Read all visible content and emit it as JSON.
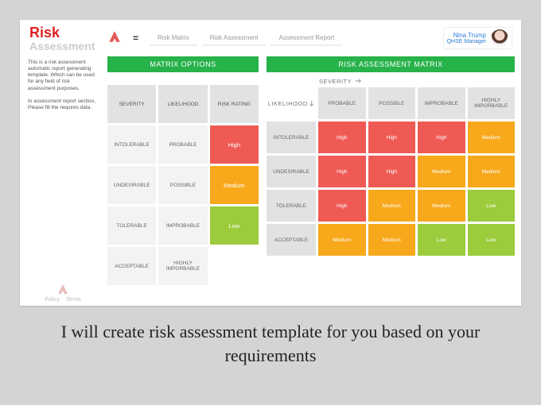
{
  "header": {
    "brand_line1": "Risk",
    "brand_line2": "Assessment",
    "hamburger": "=",
    "tabs": [
      "Risk Matrix",
      "Risk Assessment",
      "Assessment Report"
    ],
    "user_name": "Nina Trump",
    "user_role": "QHSE Manager"
  },
  "left": {
    "para1": "This is a risk assessment automatic report generating template. Which can be used for any field of risk assessment purposes.",
    "para2": "In assessment report section, Please fill the requires data.",
    "foot_links": [
      "Policy",
      "Terms"
    ]
  },
  "options": {
    "title": "MATRIX OPTIONS",
    "headers": [
      "SEVERITY",
      "LIKELIHOOD",
      "RISK RATING"
    ],
    "rows": [
      {
        "severity": "INTOLERABLE",
        "likelihood": "PROBABLE",
        "rating": "High",
        "cls": "rating-high"
      },
      {
        "severity": "UNDESIRABLE",
        "likelihood": "POSSIBLE",
        "rating": "Medium",
        "cls": "rating-medium"
      },
      {
        "severity": "TOLERABLE",
        "likelihood": "IMPROBABLE",
        "rating": "Low",
        "cls": "rating-low"
      },
      {
        "severity": "ACCEPTABLE",
        "likelihood": "HIGHLY IMPORBABLE",
        "rating": "",
        "cls": "blank"
      }
    ]
  },
  "matrix": {
    "title": "RISK ASSESSMENT MATRIX",
    "axis_severity": "SEVERITY",
    "axis_likelihood": "LIKELIHOOD",
    "col_headers": [
      "PROBABLE",
      "POSSIBLE",
      "IMPROBABLE",
      "HIGHLY IMPORBABLE"
    ],
    "row_headers": [
      "INTOLERABLE",
      "UNDESIRABLE",
      "TOLERABLE",
      "ACCEPTABLE"
    ],
    "cells": [
      [
        {
          "t": "High",
          "c": "high"
        },
        {
          "t": "High",
          "c": "high"
        },
        {
          "t": "High",
          "c": "high"
        },
        {
          "t": "Medium",
          "c": "medium"
        }
      ],
      [
        {
          "t": "High",
          "c": "high"
        },
        {
          "t": "High",
          "c": "high"
        },
        {
          "t": "Medium",
          "c": "medium"
        },
        {
          "t": "Medium",
          "c": "medium"
        }
      ],
      [
        {
          "t": "High",
          "c": "high"
        },
        {
          "t": "Medium",
          "c": "medium"
        },
        {
          "t": "Medium",
          "c": "medium"
        },
        {
          "t": "Low",
          "c": "low"
        }
      ],
      [
        {
          "t": "Medium",
          "c": "medium"
        },
        {
          "t": "Medium",
          "c": "medium"
        },
        {
          "t": "Low",
          "c": "low"
        },
        {
          "t": "Low",
          "c": "low"
        }
      ]
    ]
  },
  "caption": "I will create risk assessment template for you based on your requirements"
}
